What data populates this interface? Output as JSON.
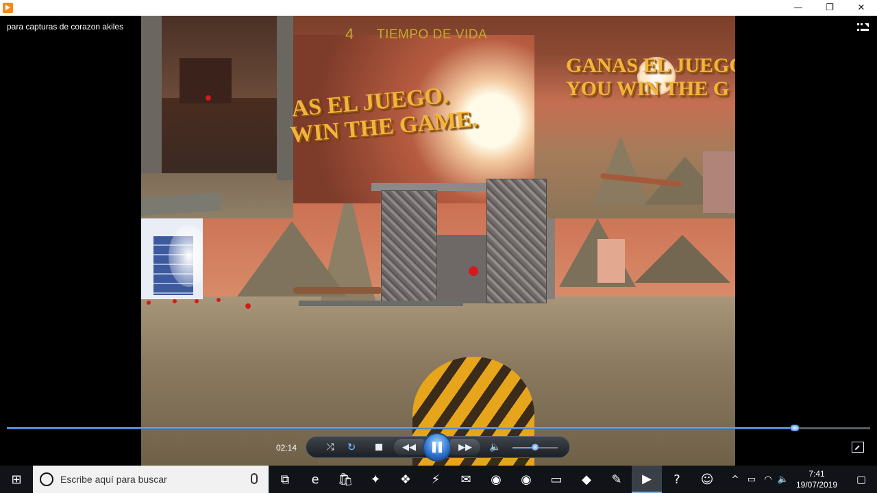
{
  "window": {
    "min_symbol": "—",
    "max_symbol": "❐",
    "close_symbol": "✕"
  },
  "player": {
    "media_title": "para capturas de corazon akiles",
    "hud_number": "4",
    "hud_label": "TIEMPO DE VIDA",
    "win_text_tr_line1": "GANAS EL JUEGO",
    "win_text_tr_line2": "YOU WIN THE G",
    "win_text_mid_line1": "AS EL JUEGO.",
    "win_text_mid_line2": "WIN THE GAME.",
    "elapsed_time": "02:14",
    "progress_fraction": 0.913,
    "volume_fraction": 0.5
  },
  "controls": {
    "shuffle_symbol": "⤮",
    "repeat_symbol": "↻",
    "prev_symbol": "◀◀",
    "next_symbol": "▶▶",
    "volume_symbol": "🔈"
  },
  "taskbar": {
    "start_symbol": "⊞",
    "search_placeholder": "Escribe aquí para buscar",
    "apps": [
      {
        "name": "task-view",
        "symbol": "⧉"
      },
      {
        "name": "edge",
        "symbol": "e"
      },
      {
        "name": "store",
        "symbol": "🛍"
      },
      {
        "name": "app-red",
        "symbol": "✦"
      },
      {
        "name": "dropbox",
        "symbol": "❖"
      },
      {
        "name": "app-bolt",
        "symbol": "⚡"
      },
      {
        "name": "mail",
        "symbol": "✉"
      },
      {
        "name": "firefox",
        "symbol": "◉"
      },
      {
        "name": "firefox-2",
        "symbol": "◉"
      },
      {
        "name": "file-explorer",
        "symbol": "▭"
      },
      {
        "name": "app-blue",
        "symbol": "◆"
      },
      {
        "name": "paint",
        "symbol": "✎"
      },
      {
        "name": "media-player",
        "symbol": "▶"
      },
      {
        "name": "help",
        "symbol": "?"
      },
      {
        "name": "people",
        "symbol": "☺"
      }
    ],
    "tray_chevron": "^",
    "tray_battery": "▭",
    "tray_wifi": "◠",
    "tray_volume": "🔈",
    "time": "7:41",
    "date": "19/07/2019",
    "notification_symbol": "▢"
  }
}
